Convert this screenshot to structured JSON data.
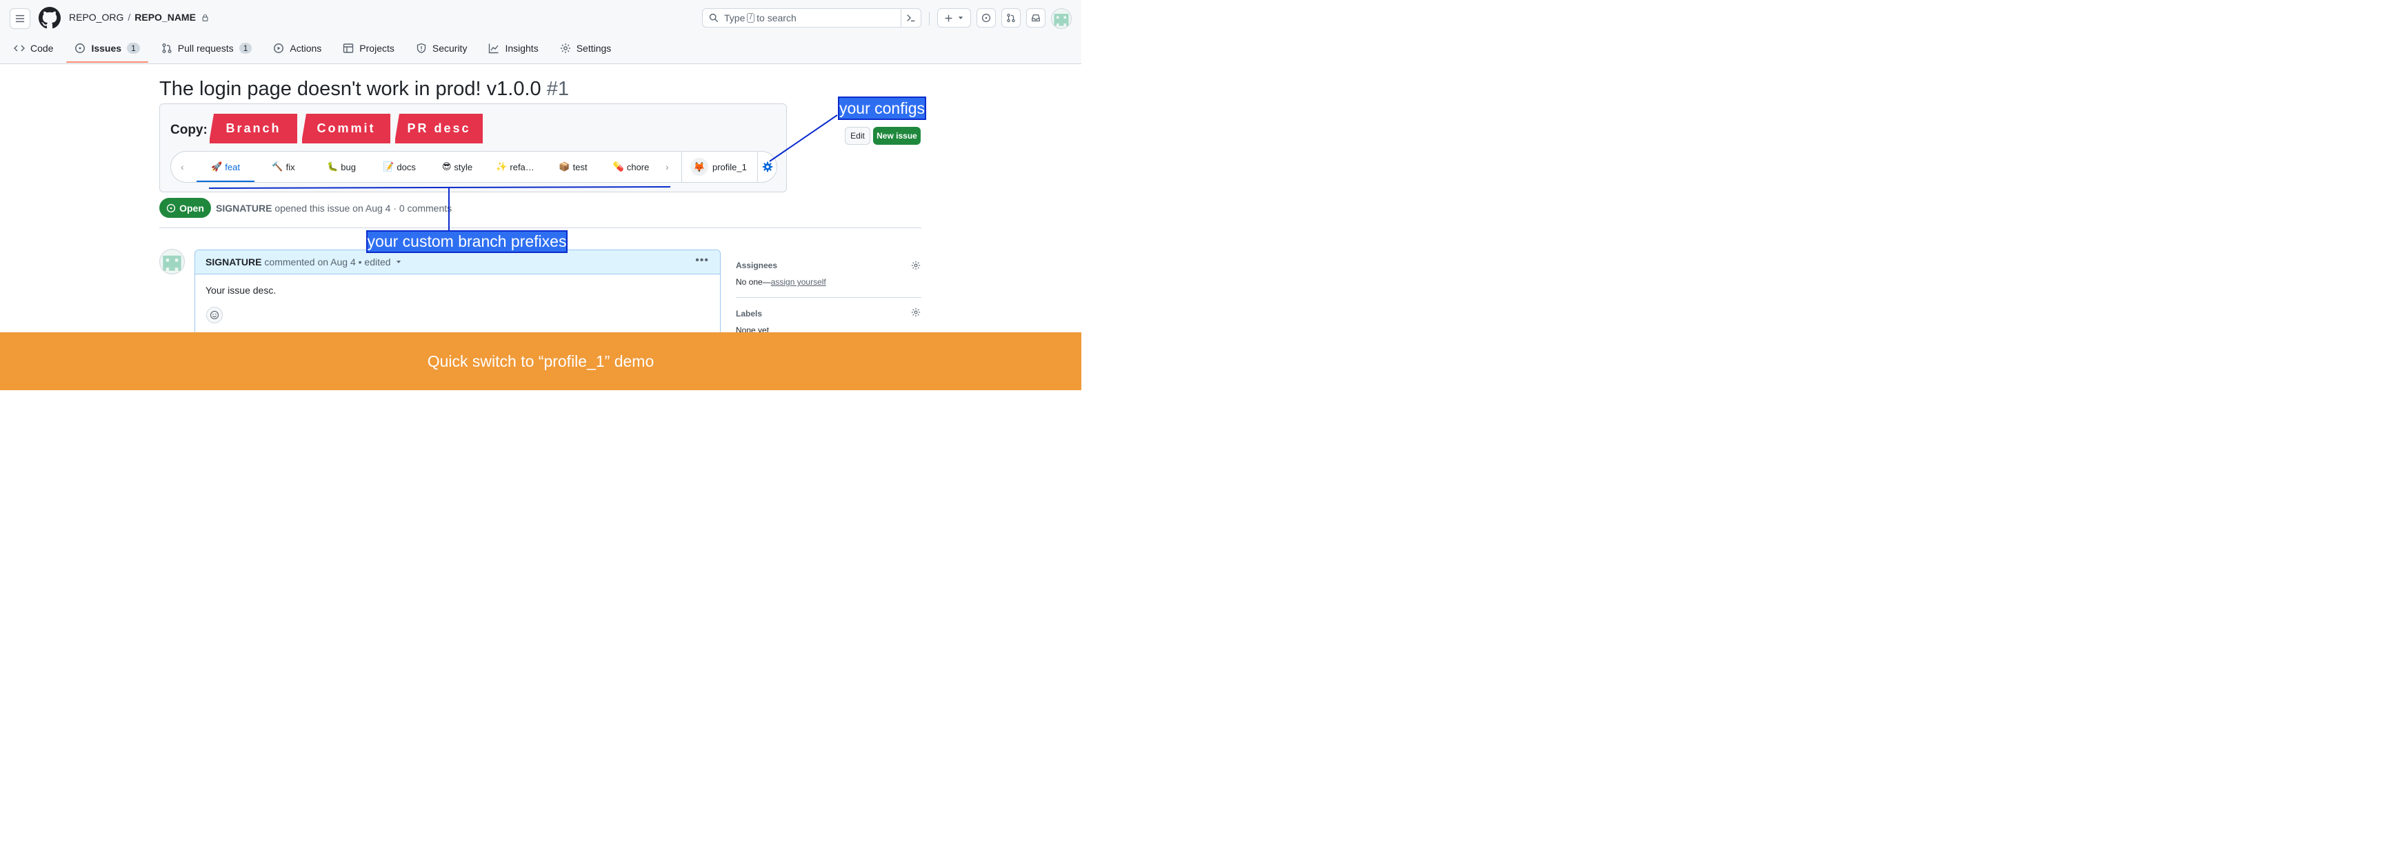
{
  "header": {
    "repo_org": "REPO_ORG",
    "separator": "/",
    "repo_name": "REPO_NAME",
    "search_prefix": "Type",
    "search_key": "/",
    "search_suffix": "to search"
  },
  "repo_nav": [
    {
      "label": "Code",
      "icon": "code-icon"
    },
    {
      "label": "Issues",
      "count": "1",
      "icon": "issue-opened-icon",
      "active": true
    },
    {
      "label": "Pull requests",
      "count": "1",
      "icon": "git-pull-request-icon"
    },
    {
      "label": "Actions",
      "icon": "play-icon"
    },
    {
      "label": "Projects",
      "icon": "table-icon"
    },
    {
      "label": "Security",
      "icon": "shield-icon"
    },
    {
      "label": "Insights",
      "icon": "graph-icon"
    },
    {
      "label": "Settings",
      "icon": "gear-icon"
    }
  ],
  "issue": {
    "title": "The login page doesn't work in prod! v1.0.0",
    "number": "#1",
    "status": "Open",
    "author": "SIGNATURE",
    "meta": "opened this issue on Aug 4 · 0 comments",
    "edit_label": "Edit",
    "new_issue_label": "New issue"
  },
  "extension": {
    "copy_label": "Copy:",
    "buttons": [
      "Branch",
      "Commit",
      "PR desc"
    ],
    "prefix_tabs": [
      {
        "emoji": "🚀",
        "label": "feat",
        "active": true
      },
      {
        "emoji": "🔨",
        "label": "fix"
      },
      {
        "emoji": "🐛",
        "label": "bug"
      },
      {
        "emoji": "📝",
        "label": "docs"
      },
      {
        "emoji": "😎",
        "label": "style"
      },
      {
        "emoji": "✨",
        "label": "refa…"
      },
      {
        "emoji": "📦",
        "label": "test"
      },
      {
        "emoji": "💊",
        "label": "chore"
      }
    ],
    "profile_name": "profile_1",
    "prev_glyph": "‹",
    "next_glyph": "›"
  },
  "comment": {
    "author": "SIGNATURE",
    "meta": "commented on Aug 4 • edited",
    "body": "Your issue desc."
  },
  "sidebar": {
    "assignees_heading": "Assignees",
    "assignees_value": "No one—",
    "assign_link": "assign yourself",
    "labels_heading": "Labels",
    "labels_value": "None yet"
  },
  "annotations": {
    "configs": "your configs",
    "prefixes": "your custom branch prefixes"
  },
  "banner": {
    "text": "Quick switch to “profile_1” demo"
  },
  "colors": {
    "copy_button": "#e5334b",
    "annotation": "#2e6ff2",
    "banner": "#f09a38",
    "open_status": "#1f883d",
    "active_tab": "#0969da"
  }
}
